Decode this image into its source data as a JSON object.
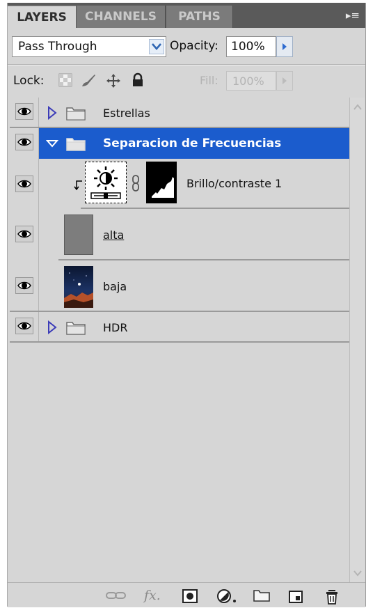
{
  "tabs": [
    {
      "label": "LAYERS",
      "active": true
    },
    {
      "label": "CHANNELS",
      "active": false
    },
    {
      "label": "PATHS",
      "active": false
    }
  ],
  "blend_mode": {
    "value": "Pass Through"
  },
  "opacity": {
    "label": "Opacity:",
    "value": "100%"
  },
  "lock": {
    "label": "Lock:"
  },
  "fill": {
    "label": "Fill:",
    "value": "100%"
  },
  "layers": [
    {
      "name": "Estrellas",
      "type": "group",
      "expanded": false,
      "visible": true
    },
    {
      "name": "Separacion de Frecuencias",
      "type": "group",
      "expanded": true,
      "visible": true,
      "selected": true
    },
    {
      "name": "Brillo/contraste 1",
      "type": "adjustment",
      "clipped": true,
      "visible": true
    },
    {
      "name": "alta",
      "type": "layer",
      "visible": true
    },
    {
      "name": "baja",
      "type": "layer",
      "visible": true
    },
    {
      "name": "HDR",
      "type": "group",
      "expanded": false,
      "visible": true
    }
  ],
  "colors": {
    "selection": "#1b5ccd",
    "panel": "#d6d6d6",
    "tabbar": "#5a5a5a"
  }
}
